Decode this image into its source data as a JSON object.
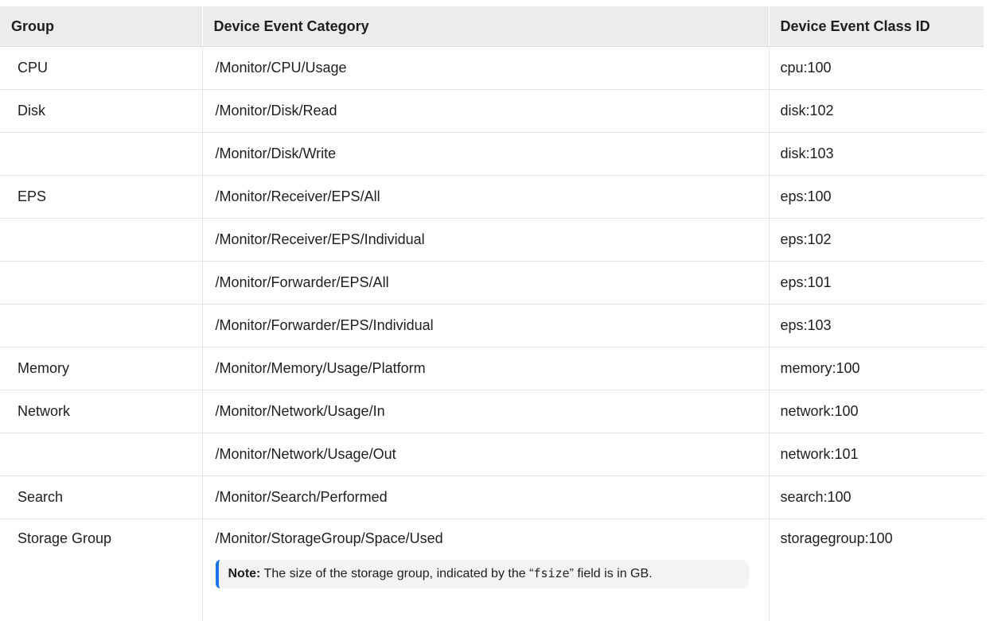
{
  "table": {
    "headers": [
      "Group",
      "Device Event Category",
      "Device Event Class ID"
    ],
    "rows": [
      [
        "CPU",
        "/Monitor/CPU/Usage",
        "cpu:100"
      ],
      [
        "Disk",
        "/Monitor/Disk/Read",
        "disk:102"
      ],
      [
        "",
        "/Monitor/Disk/Write",
        "disk:103"
      ],
      [
        "EPS",
        "/Monitor/Receiver/EPS/All",
        "eps:100"
      ],
      [
        "",
        "/Monitor/Receiver/EPS/Individual",
        "eps:102"
      ],
      [
        "",
        "/Monitor/Forwarder/EPS/All",
        "eps:101"
      ],
      [
        "",
        "/Monitor/Forwarder/EPS/Individual",
        "eps:103"
      ],
      [
        "Memory",
        "/Monitor/Memory/Usage/Platform",
        "memory:100"
      ],
      [
        "Network",
        "/Monitor/Network/Usage/In",
        "network:100"
      ],
      [
        "",
        "/Monitor/Network/Usage/Out",
        "network:101"
      ],
      [
        "Search",
        "/Monitor/Search/Performed",
        "search:100"
      ],
      [
        "Storage Group",
        "/Monitor/StorageGroup/Space/Used",
        "storagegroup:100"
      ]
    ]
  },
  "note": {
    "label": "Note:",
    "text_before": " The size of the storage group, indicated by the “",
    "code": "fsize",
    "text_after": "” field is in GB."
  },
  "colors": {
    "header_bg": "#ececec",
    "note_bg": "#f3f3f3",
    "note_accent": "#1a73e8",
    "border": "#e3e3e3"
  }
}
